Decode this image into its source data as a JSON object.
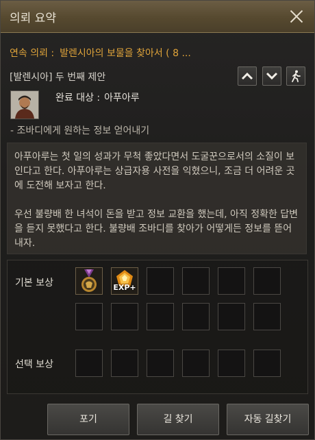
{
  "window": {
    "title": "의뢰 요약"
  },
  "quest": {
    "chain_label": "연속 의뢰 :",
    "chain_name": "발렌시아의 보물을 찾아서 ( 8 ...",
    "subtitle": "[발렌시아] 두 번째 제안",
    "target_label": "완료 대상 :",
    "target_name": "아푸아루",
    "objective": "- 조바디에게 원하는 정보 얻어내기"
  },
  "description": {
    "p1": "아푸아루는 첫 일의 성과가 무척 좋았다면서 도굴꾼으로서의 소질이 보인다고 한다. 아푸아루는 상급자용 사전을 익혔으니, 조금 더 어려운 곳에 도전해 보자고 한다.",
    "p2": "우선 불량배 한 녀석이 돈을 받고 정보 교환을 했는데, 아직 정확한 답변을 듣지 못했다고 한다. 불량배 조바디를 찾아가 어떻게든 정보를 뜯어 내자."
  },
  "rewards": {
    "basic_label": "기본 보상",
    "choice_label": "선택 보상",
    "basic_items": [
      {
        "icon": "medal-icon"
      },
      {
        "icon": "exp-gem-icon",
        "caption": "EXP+"
      }
    ]
  },
  "buttons": {
    "give_up": "포기",
    "find_path": "길 찾기",
    "auto_path": "자동 길찾기"
  },
  "nav_icons": [
    "chevron-up-icon",
    "chevron-down-icon",
    "walking-person-icon"
  ],
  "colors": {
    "accent": "#e0a43a",
    "title_bar": "#56492f"
  }
}
